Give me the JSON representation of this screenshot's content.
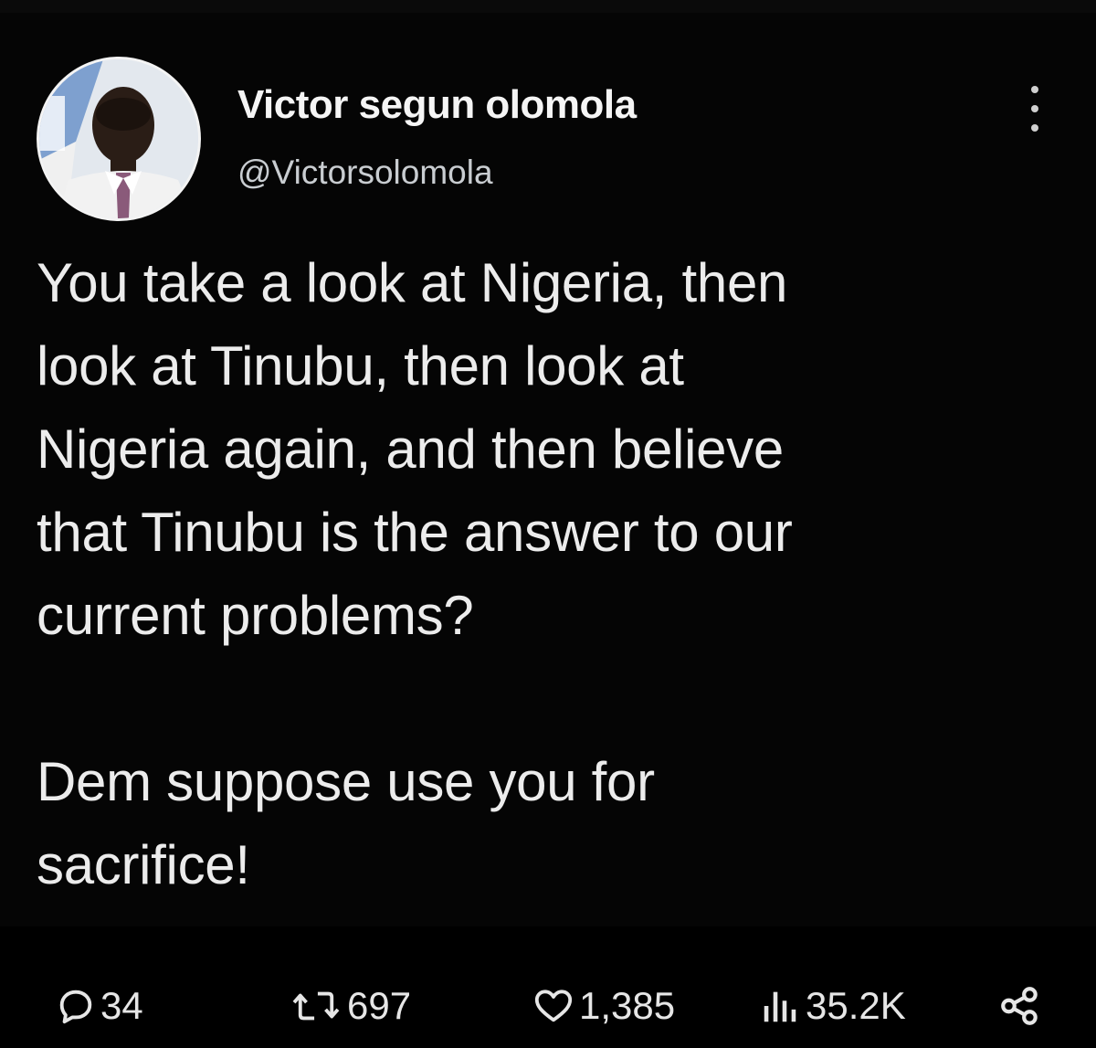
{
  "tweet": {
    "author": {
      "display_name": "Victor segun olomola",
      "handle": "@Victorsolomola"
    },
    "paragraphs": [
      "You take a look at Nigeria, then\nlook at Tinubu, then look at\nNigeria again, and then believe\nthat Tinubu is the answer to our\ncurrent problems?",
      "Dem suppose use you for\nsacrifice!"
    ],
    "actions": {
      "replies": "34",
      "retweets": "697",
      "likes": "1,385",
      "views": "35.2K"
    },
    "icons": {
      "reply": "reply-icon",
      "retweet": "retweet-icon",
      "like": "heart-icon",
      "views": "views-icon",
      "share": "share-icon",
      "more": "more-options-icon"
    },
    "colors": {
      "background": "#000000",
      "text": "#e7e9ea",
      "secondary_text": "#c9cdd1"
    }
  }
}
